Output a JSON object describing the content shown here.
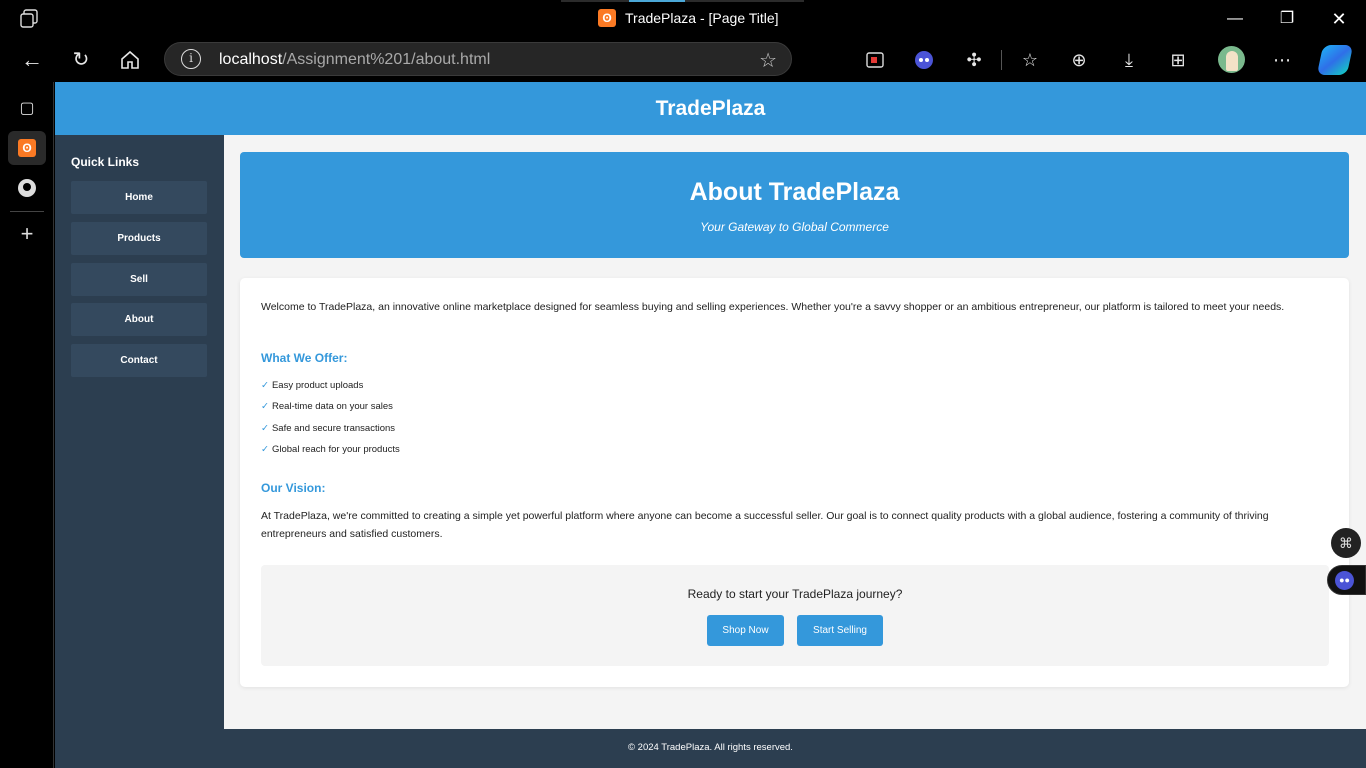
{
  "browser": {
    "window_title": "TradePlaza - [Page Title]",
    "url_host": "localhost",
    "url_path": "/Assignment%201/about.html",
    "icons": [
      "collections-icon",
      "back-icon",
      "refresh-icon",
      "home-icon",
      "info-icon",
      "favorite-star-icon",
      "screen-record-icon",
      "bot-extension-icon",
      "extensions-icon",
      "favorites-icon",
      "collections-add-icon",
      "downloads-icon",
      "apps-icon",
      "profile-avatar",
      "more-icon",
      "copilot-icon",
      "minimize-icon",
      "restore-icon",
      "close-icon"
    ]
  },
  "site": {
    "brand": "TradePlaza",
    "sidebar": {
      "heading": "Quick Links",
      "items": [
        {
          "label": "Home"
        },
        {
          "label": "Products"
        },
        {
          "label": "Sell"
        },
        {
          "label": "About"
        },
        {
          "label": "Contact"
        }
      ]
    },
    "hero": {
      "title": "About TradePlaza",
      "subtitle": "Your Gateway to Global Commerce"
    },
    "content": {
      "intro": "Welcome to TradePlaza, an innovative online marketplace designed for seamless buying and selling experiences. Whether you're a savvy shopper or an ambitious entrepreneur, our platform is tailored to meet your needs.",
      "offer_heading": "What We Offer:",
      "check_mark": "✓",
      "offers": [
        "Easy product uploads",
        "Real-time data on your sales",
        "Safe and secure transactions",
        "Global reach for your products"
      ],
      "vision_heading": "Our Vision:",
      "vision": "At TradePlaza, we're committed to creating a simple yet powerful platform where anyone can become a successful seller. Our goal is to connect quality products with a global audience, fostering a community of thriving entrepreneurs and satisfied customers."
    },
    "cta": {
      "prompt": "Ready to start your TradePlaza journey?",
      "shop_label": "Shop Now",
      "sell_label": "Start Selling"
    },
    "footer": "© 2024 TradePlaza. All rights reserved."
  },
  "colors": {
    "primary": "#3498db",
    "dark": "#2c3e50",
    "nav_button": "#34495e",
    "page_bg": "#f4f4f4"
  }
}
